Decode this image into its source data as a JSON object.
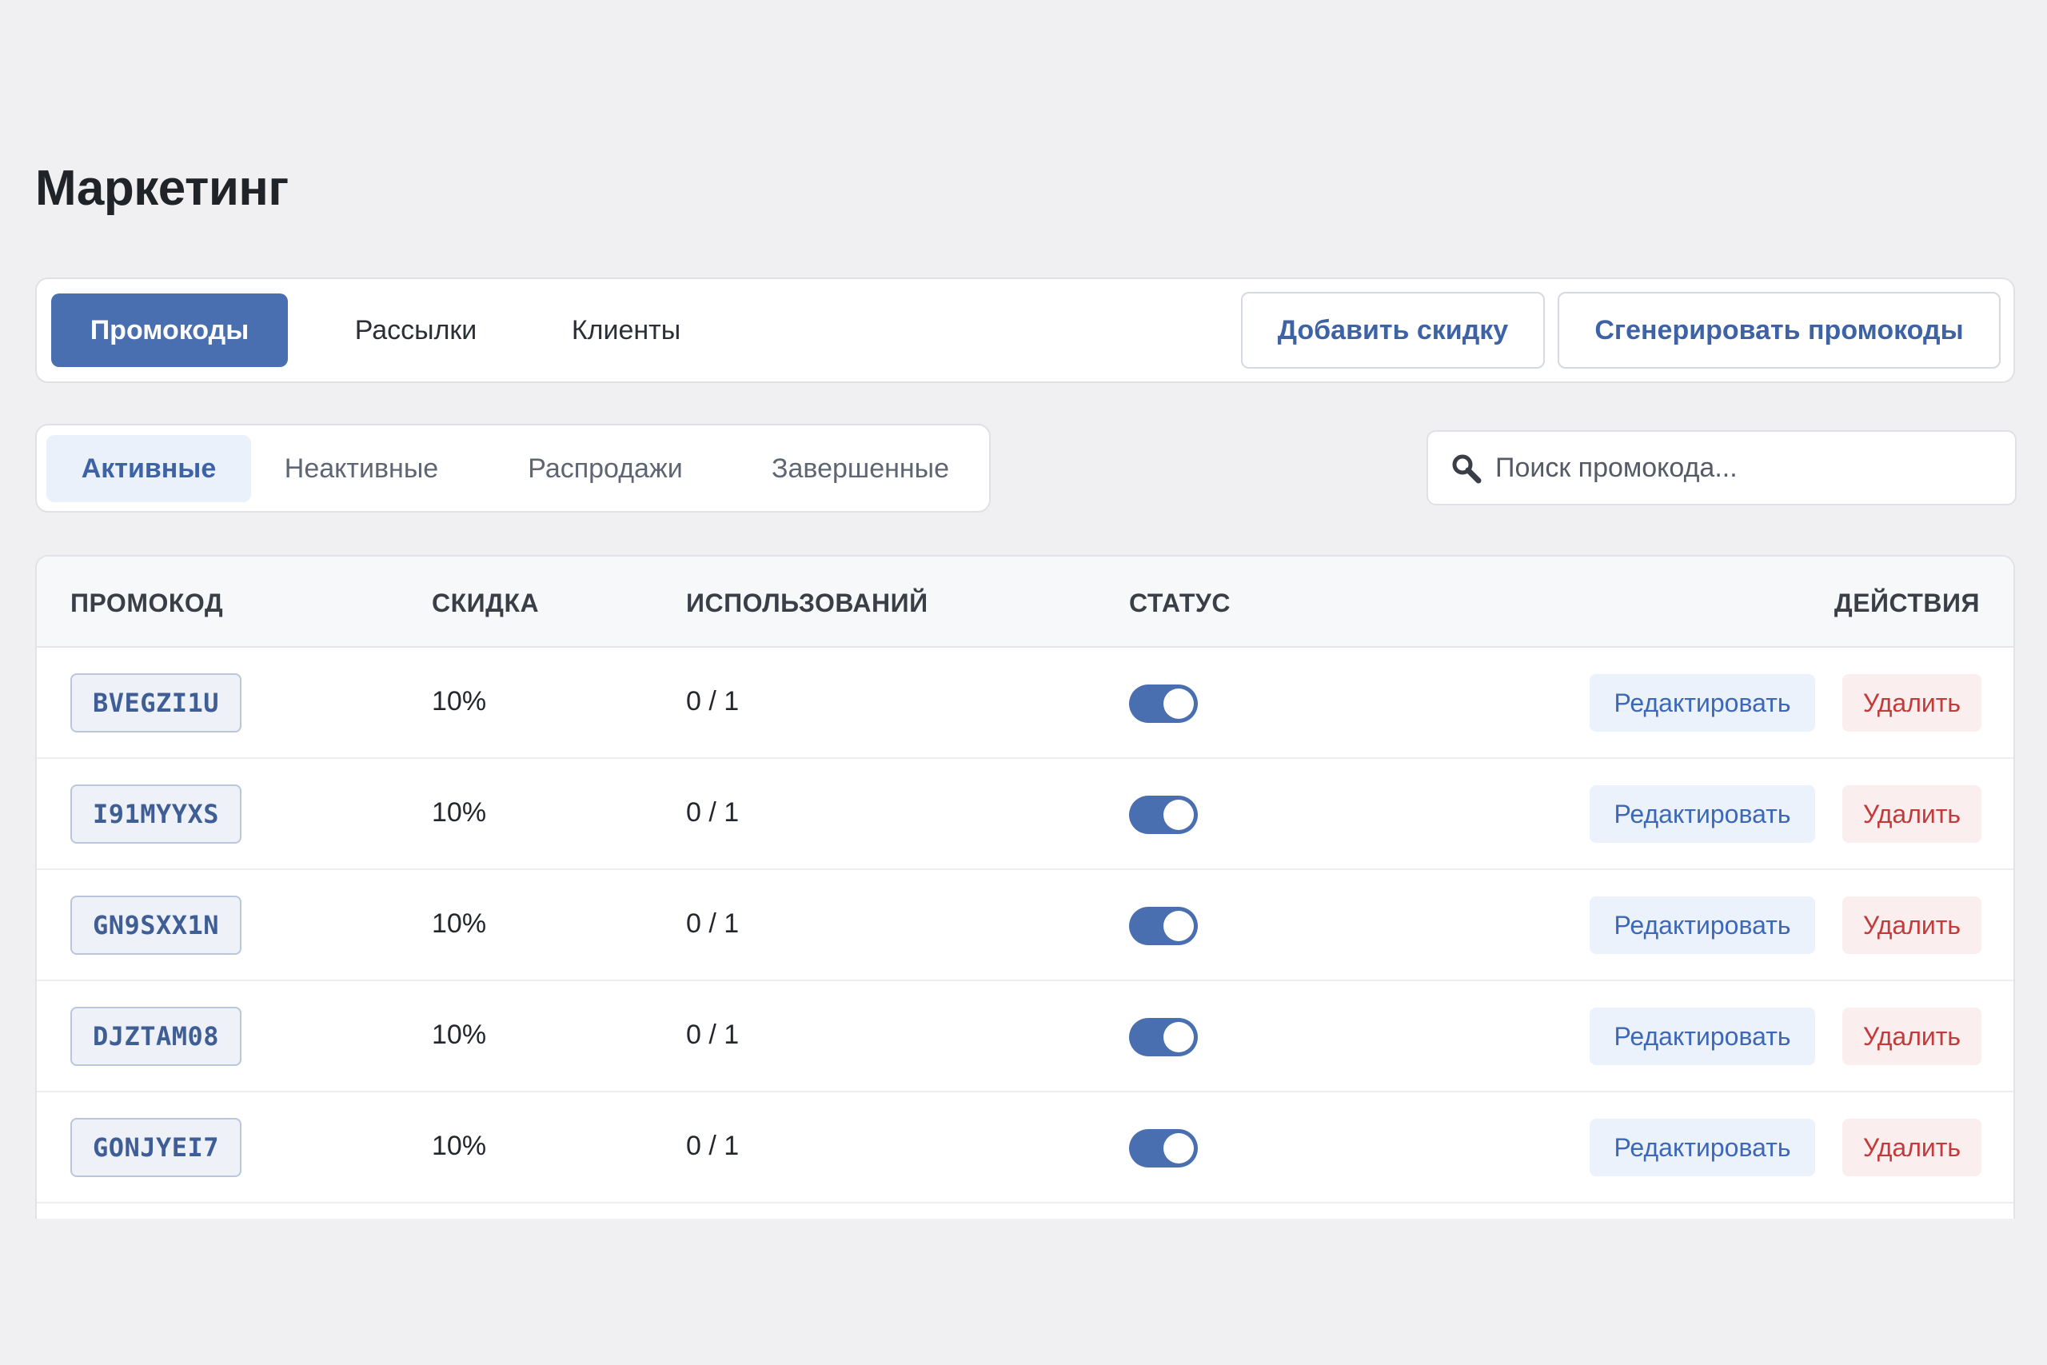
{
  "page": {
    "title": "Маркетинг"
  },
  "main_tabs": [
    {
      "label": "Промокоды",
      "active": true
    },
    {
      "label": "Рассылки",
      "active": false
    },
    {
      "label": "Клиенты",
      "active": false
    }
  ],
  "actions": {
    "add_discount": "Добавить скидку",
    "generate_codes": "Сгенерировать промокоды"
  },
  "filter_tabs": [
    {
      "label": "Активные",
      "active": true
    },
    {
      "label": "Неактивные",
      "active": false
    },
    {
      "label": "Распродажи",
      "active": false
    },
    {
      "label": "Завершенные",
      "active": false
    }
  ],
  "search": {
    "placeholder": "Поиск промокода...",
    "icon": "search-icon"
  },
  "table": {
    "headers": {
      "code": "ПРОМОКОД",
      "discount": "СКИДКА",
      "uses": "ИСПОЛЬЗОВАНИЙ",
      "status": "СТАТУС",
      "actions": "ДЕЙСТВИЯ"
    },
    "rows": [
      {
        "code": "BVEGZI1U",
        "discount": "10%",
        "uses": "0 / 1",
        "status_on": true,
        "edit": "Редактировать",
        "delete": "Удалить"
      },
      {
        "code": "I91MYYXS",
        "discount": "10%",
        "uses": "0 / 1",
        "status_on": true,
        "edit": "Редактировать",
        "delete": "Удалить"
      },
      {
        "code": "GN9SXX1N",
        "discount": "10%",
        "uses": "0 / 1",
        "status_on": true,
        "edit": "Редактировать",
        "delete": "Удалить"
      },
      {
        "code": "DJZTAM08",
        "discount": "10%",
        "uses": "0 / 1",
        "status_on": true,
        "edit": "Редактировать",
        "delete": "Удалить"
      },
      {
        "code": "GONJYEI7",
        "discount": "10%",
        "uses": "0 / 1",
        "status_on": true,
        "edit": "Редактировать",
        "delete": "Удалить"
      }
    ]
  },
  "colors": {
    "primary": "#4a6fb0",
    "link": "#3d62a5",
    "danger": "#c33a3a",
    "background": "#f0f0f2"
  }
}
